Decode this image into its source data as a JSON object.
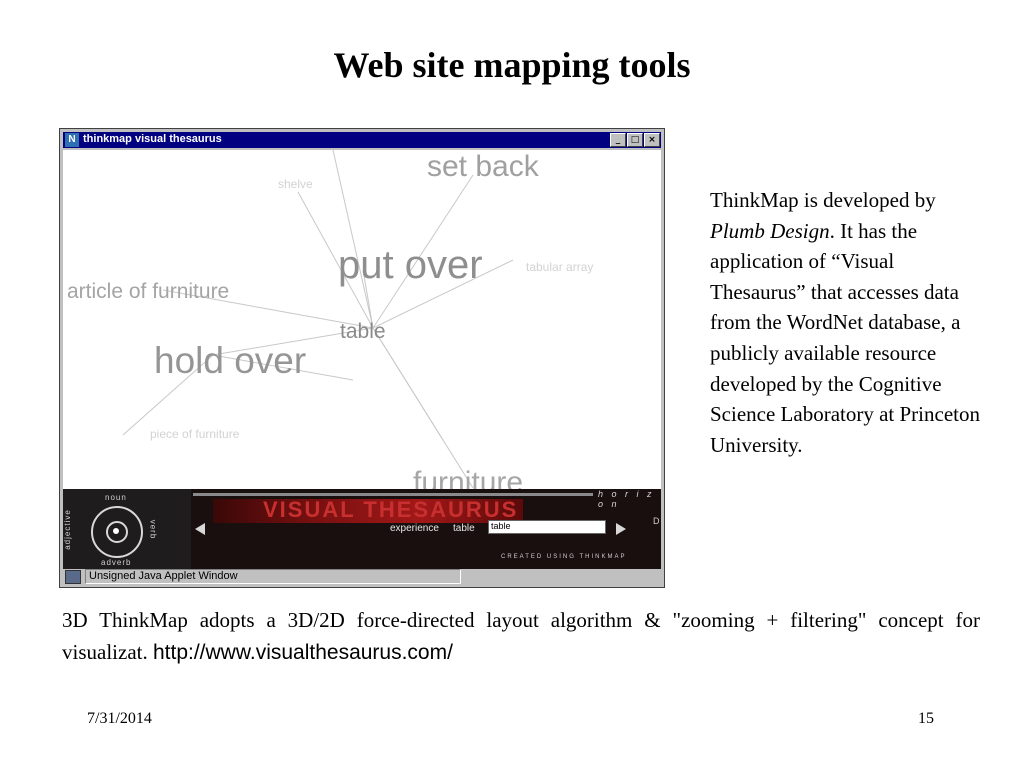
{
  "slide": {
    "title": "Web site mapping tools",
    "footer_date": "7/31/2014",
    "page_number": "15"
  },
  "window": {
    "title": "thinkmap visual thesaurus",
    "app_icon_glyph": "N",
    "buttons": {
      "minimize": "_",
      "maximize": "□",
      "close": "×"
    },
    "status_text": "Unsigned Java Applet Window"
  },
  "map": {
    "words": {
      "set_back": "set back",
      "shelve": "shelve",
      "tabular_array": "tabular array",
      "put_over": "put over",
      "article_of_furniture": "article of furniture",
      "table": "table",
      "hold_over": "hold over",
      "piece_of_furniture": "piece of furniture",
      "furniture": "furniture"
    }
  },
  "control_bar": {
    "banner_text": "VISUAL THESAURUS",
    "horizon_label": "h o r i z o n",
    "compass_labels": {
      "top": "noun",
      "left": "adjective",
      "right": "verb",
      "bottom": "adverb"
    },
    "trail": [
      "experience",
      "table"
    ],
    "input_value": "table",
    "created_text": "CREATED USING THINKMAP",
    "side_letters": "D"
  },
  "description": {
    "line1_pre": "ThinkMap is developed by ",
    "developer": "Plumb Design",
    "line1_post": ". It has the application of “Visual Thesaurus” that accesses data from the WordNet database, a publicly available resource developed by the Cognitive Science Laboratory at Princeton University."
  },
  "caption": {
    "text": "3D ThinkMap adopts a 3D/2D force-directed layout algorithm & \"zooming + filtering\" concept for visualizat. ",
    "url": "http://www.visualthesaurus.com/"
  },
  "colors": {
    "titlebar": "#000080",
    "chrome": "#c0c0c0",
    "word_gray": "#9a9a9a",
    "banner_red": "#a21818"
  }
}
